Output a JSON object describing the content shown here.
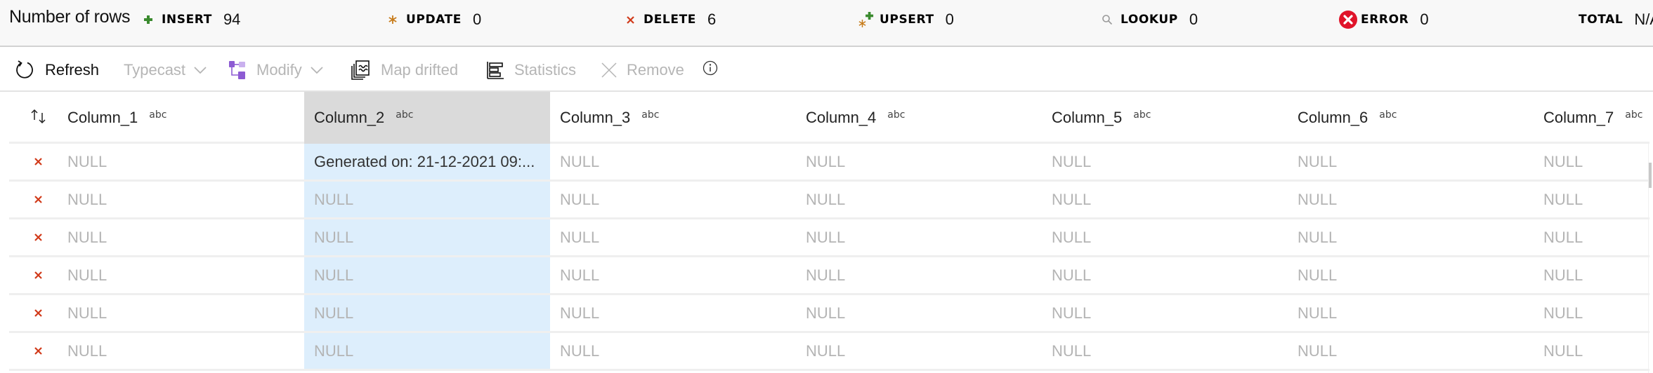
{
  "summary": {
    "title": "Number of rows",
    "stats": [
      {
        "key": "insert",
        "label": "INSERT",
        "value": "94",
        "icon": "plus-icon",
        "color": "#3a8a2e"
      },
      {
        "key": "update",
        "label": "UPDATE",
        "value": "0",
        "icon": "asterisk-icon",
        "color": "#c77b1a"
      },
      {
        "key": "delete",
        "label": "DELETE",
        "value": "6",
        "icon": "x-icon",
        "color": "#d13a1a"
      },
      {
        "key": "upsert",
        "label": "UPSERT",
        "value": "0",
        "icon": "upsert-icon",
        "color": "#3a8a2e"
      },
      {
        "key": "lookup",
        "label": "LOOKUP",
        "value": "0",
        "icon": "search-icon",
        "color": "#9a9a9a"
      },
      {
        "key": "error",
        "label": "ERROR",
        "value": "0",
        "icon": "error-circle-icon",
        "color": "#e0142a"
      },
      {
        "key": "total",
        "label": "TOTAL",
        "value": "N/A",
        "icon": "",
        "color": "#000000"
      }
    ]
  },
  "toolbar": {
    "refresh": "Refresh",
    "typecast": "Typecast",
    "modify": "Modify",
    "map_drifted": "Map drifted",
    "statistics": "Statistics",
    "remove": "Remove"
  },
  "grid": {
    "columns": [
      {
        "name": "Column_1",
        "type": "abc"
      },
      {
        "name": "Column_2",
        "type": "abc",
        "selected": true
      },
      {
        "name": "Column_3",
        "type": "abc"
      },
      {
        "name": "Column_4",
        "type": "abc"
      },
      {
        "name": "Column_5",
        "type": "abc"
      },
      {
        "name": "Column_6",
        "type": "abc"
      },
      {
        "name": "Column_7",
        "type": "abc"
      }
    ],
    "rows": [
      {
        "marker": "delete",
        "cells": [
          "NULL",
          "Generated on: 21-12-2021 09:...",
          "NULL",
          "NULL",
          "NULL",
          "NULL",
          "NULL"
        ]
      },
      {
        "marker": "delete",
        "cells": [
          "NULL",
          "NULL",
          "NULL",
          "NULL",
          "NULL",
          "NULL",
          "NULL"
        ]
      },
      {
        "marker": "delete",
        "cells": [
          "NULL",
          "NULL",
          "NULL",
          "NULL",
          "NULL",
          "NULL",
          "NULL"
        ]
      },
      {
        "marker": "delete",
        "cells": [
          "NULL",
          "NULL",
          "NULL",
          "NULL",
          "NULL",
          "NULL",
          "NULL"
        ]
      },
      {
        "marker": "delete",
        "cells": [
          "NULL",
          "NULL",
          "NULL",
          "NULL",
          "NULL",
          "NULL",
          "NULL"
        ]
      },
      {
        "marker": "delete",
        "cells": [
          "NULL",
          "NULL",
          "NULL",
          "NULL",
          "NULL",
          "NULL",
          "NULL"
        ]
      }
    ],
    "colors": {
      "delete_marker": "#d13a1a",
      "selected_header": "#dadada",
      "selected_cell": "#ddeefc",
      "null_text": "#b4b4b4"
    }
  }
}
